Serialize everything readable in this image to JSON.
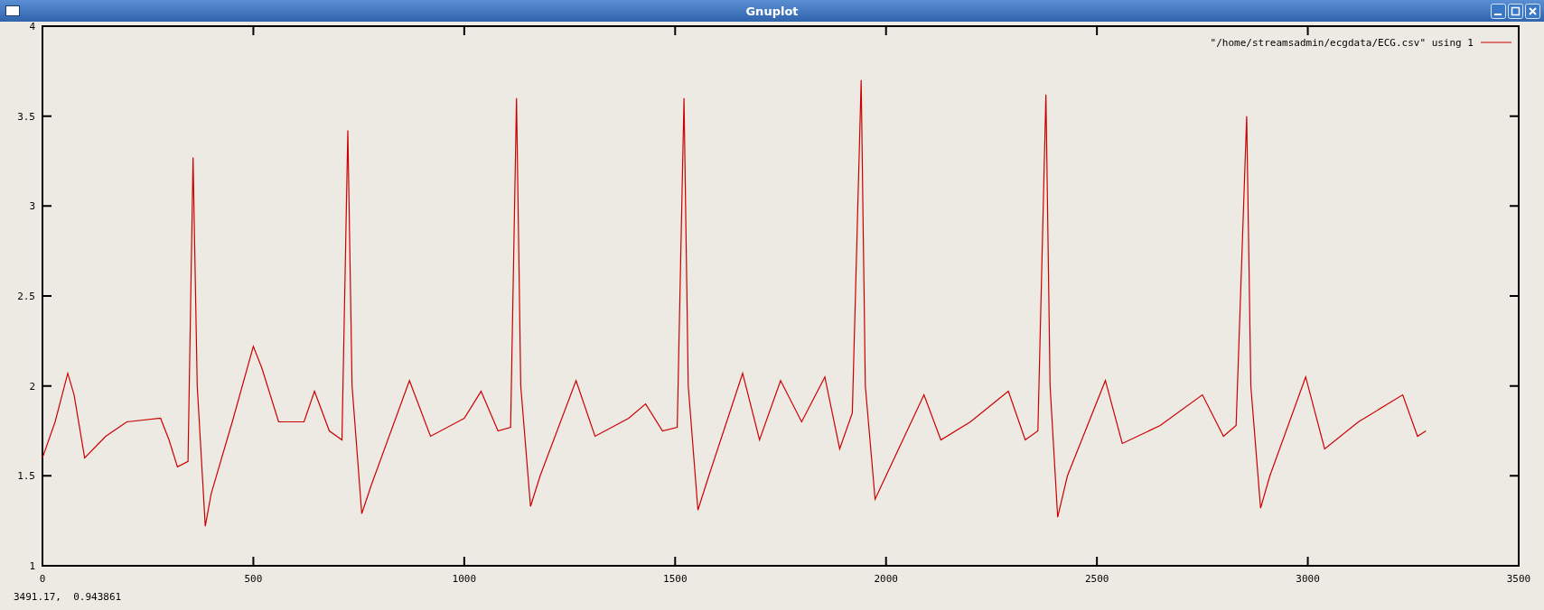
{
  "window": {
    "title": "Gnuplot"
  },
  "plot": {
    "chart_data": {
      "type": "line",
      "xlim": [
        0,
        3500
      ],
      "ylim": [
        1,
        4
      ],
      "xticks": [
        0,
        500,
        1000,
        1500,
        2000,
        2500,
        3000,
        3500
      ],
      "yticks": [
        1,
        1.5,
        2,
        2.5,
        3,
        3.5,
        4
      ],
      "x": [
        0,
        30,
        60,
        75,
        100,
        150,
        200,
        280,
        300,
        320,
        345,
        357,
        367,
        386,
        400,
        450,
        500,
        520,
        560,
        620,
        645,
        680,
        710,
        724,
        734,
        757,
        780,
        870,
        920,
        1000,
        1040,
        1080,
        1110,
        1124,
        1134,
        1157,
        1180,
        1265,
        1310,
        1390,
        1430,
        1470,
        1505,
        1521,
        1531,
        1554,
        1580,
        1660,
        1700,
        1750,
        1800,
        1855,
        1890,
        1920,
        1941,
        1951,
        1974,
        2000,
        2090,
        2130,
        2200,
        2290,
        2330,
        2360,
        2379,
        2389,
        2407,
        2430,
        2520,
        2560,
        2650,
        2750,
        2800,
        2830,
        2855,
        2865,
        2888,
        2910,
        2995,
        3040,
        3120,
        3225,
        3260,
        3280
      ],
      "series": [
        {
          "name": "\"/home/streamsadmin/ecgdata/ECG.csv\" using 1",
          "color": "#cc0000",
          "values": [
            1.6,
            1.8,
            2.07,
            1.95,
            1.6,
            1.72,
            1.8,
            1.82,
            1.7,
            1.55,
            1.58,
            3.27,
            2.0,
            1.22,
            1.4,
            1.8,
            2.22,
            2.1,
            1.8,
            1.8,
            1.97,
            1.75,
            1.7,
            3.42,
            2.0,
            1.29,
            1.45,
            2.03,
            1.72,
            1.82,
            1.97,
            1.75,
            1.77,
            3.6,
            2.0,
            1.33,
            1.5,
            2.03,
            1.72,
            1.82,
            1.9,
            1.75,
            1.77,
            3.6,
            2.0,
            1.31,
            1.5,
            2.07,
            1.7,
            2.03,
            1.8,
            2.05,
            1.65,
            1.85,
            3.7,
            2.0,
            1.37,
            1.5,
            1.95,
            1.7,
            1.8,
            1.97,
            1.7,
            1.75,
            3.62,
            2.0,
            1.27,
            1.5,
            2.03,
            1.68,
            1.78,
            1.95,
            1.72,
            1.78,
            3.5,
            2.0,
            1.32,
            1.5,
            2.05,
            1.65,
            1.8,
            1.95,
            1.72,
            1.75
          ]
        }
      ]
    }
  },
  "status_bar": {
    "text": "3491.17,  0.943861"
  }
}
